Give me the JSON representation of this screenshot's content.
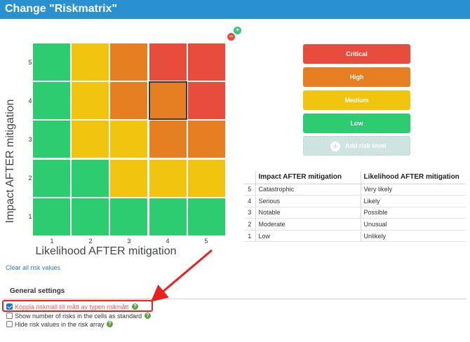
{
  "titlebar": {
    "title": "Change \"Riskmatrix\""
  },
  "matrix": {
    "y_axis_label": "Impact AFTER mitigation",
    "x_axis_label": "Likelihood AFTER mitigation",
    "y_ticks": [
      "5",
      "4",
      "3",
      "2",
      "1"
    ],
    "x_ticks": [
      "1",
      "2",
      "3",
      "4",
      "5"
    ],
    "rows": [
      [
        "Low",
        "Medium",
        "High",
        "Critical",
        "Critical"
      ],
      [
        "Low",
        "Medium",
        "High",
        "High",
        "Critical"
      ],
      [
        "Low",
        "Medium",
        "Medium",
        "High",
        "High"
      ],
      [
        "Low",
        "Low",
        "Medium",
        "Medium",
        "Medium"
      ],
      [
        "Low",
        "Low",
        "Low",
        "Low",
        "Low"
      ]
    ],
    "selected_cell": {
      "impact": 4,
      "likelihood": 4
    },
    "colors": {
      "Low": "#2ecc71",
      "Medium": "#f1c40f",
      "High": "#e67e22",
      "Critical": "#e74c3c"
    }
  },
  "mini_buttons": {
    "add": "+",
    "remove": "−"
  },
  "risk_levels": [
    {
      "label": "Critical",
      "color": "#e74c3c"
    },
    {
      "label": "High",
      "color": "#e67e22"
    },
    {
      "label": "Medium",
      "color": "#f1c40f"
    },
    {
      "label": "Low",
      "color": "#2ecc71"
    }
  ],
  "add_level": {
    "icon": "+",
    "label": "Add risk level"
  },
  "legend_table": {
    "headers": [
      "",
      "Impact AFTER mitigation",
      "Likelihood AFTER mitigation"
    ],
    "rows": [
      [
        "5",
        "Catastrophic",
        "Very likely"
      ],
      [
        "4",
        "Serious",
        "Likely"
      ],
      [
        "3",
        "Notable",
        "Possible"
      ],
      [
        "2",
        "Moderate",
        "Unusual"
      ],
      [
        "1",
        "Low",
        "Unlikely"
      ]
    ]
  },
  "clear_link": "Clear all risk values",
  "general_settings": {
    "title": "General settings",
    "options": [
      {
        "label": "Koppla riskmall till mått av typen riskmått",
        "checked": true,
        "help": "?"
      },
      {
        "label": "Show number of risks in the cells as standard",
        "checked": false,
        "help": "?"
      },
      {
        "label": "Hide risk values in the risk array",
        "checked": false,
        "help": "?"
      }
    ]
  }
}
